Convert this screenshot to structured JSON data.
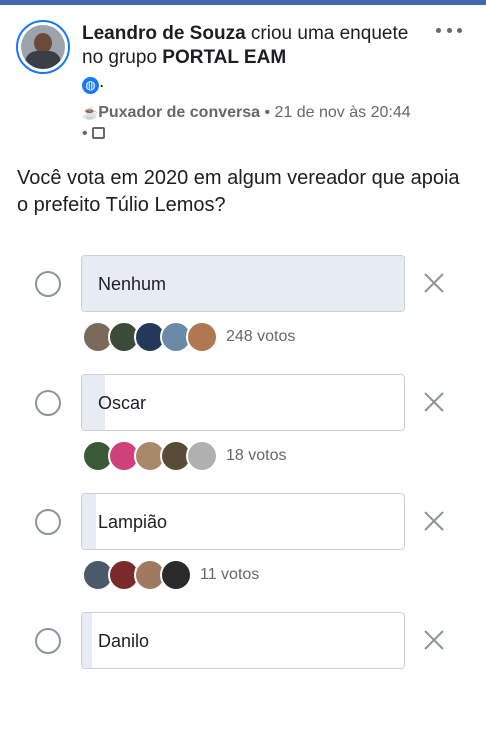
{
  "post": {
    "author": "Leandro de Souza",
    "action": " criou uma enquete no grupo ",
    "group": "PORTAL EAM",
    "period": ".",
    "badge": "Puxador de conversa",
    "timestamp": " • 21 de nov às 20:44 • ",
    "question": "Você vota em 2020 em algum vereador que apoia o prefeito Túlio Lemos?"
  },
  "poll": {
    "options": [
      {
        "label": "Nenhum",
        "votes": "248 votos",
        "share": 1.0,
        "voter_colors": [
          "#7a6a5a",
          "#3c4a3a",
          "#24395a",
          "#6a8aa8",
          "#b07850"
        ]
      },
      {
        "label": "Oscar",
        "votes": "18 votos",
        "share": 0.07,
        "voter_colors": [
          "#3a5a3a",
          "#d0407a",
          "#a88a6a",
          "#5a4a3a",
          "#b0b0b0"
        ]
      },
      {
        "label": "Lampião",
        "votes": "11 votos",
        "share": 0.045,
        "voter_colors": [
          "#4a5a6a",
          "#7a2a2a",
          "#a07a60",
          "#2a2a2a"
        ]
      },
      {
        "label": "Danilo",
        "votes": "",
        "share": 0.03,
        "voter_colors": []
      }
    ]
  },
  "colors": {
    "accent": "#1877f2",
    "fill": "#e7ebf3",
    "meta": "#65676b"
  },
  "icons": {
    "more": "more-options-icon",
    "globe": "globe-icon",
    "remove": "close-icon",
    "badge": "coffee-cup-icon",
    "group": "group-icon"
  }
}
